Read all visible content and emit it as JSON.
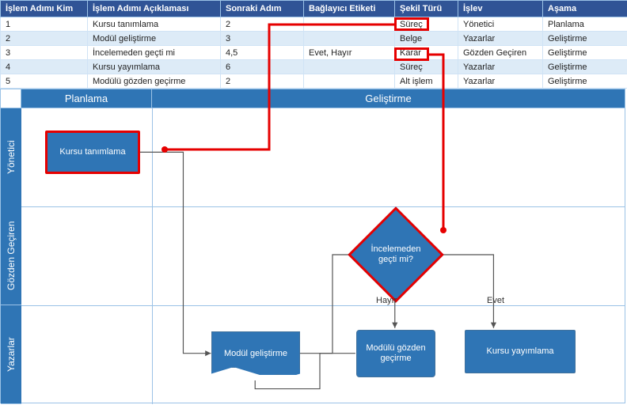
{
  "table": {
    "headers": [
      "İşlem Adımı Kim",
      "İşlem Adımı Açıklaması",
      "Sonraki Adım",
      "Bağlayıcı Etiketi",
      "Şekil Türü",
      "İşlev",
      "Aşama"
    ],
    "highlighted_header_index": 4,
    "rows": [
      {
        "id": "1",
        "desc": "Kursu tanımlama",
        "next": "2",
        "connector": "",
        "shape": "Süreç",
        "func": "Yönetici",
        "stage": "Planlama"
      },
      {
        "id": "2",
        "desc": "Modül geliştirme",
        "next": "3",
        "connector": "",
        "shape": "Belge",
        "func": "Yazarlar",
        "stage": "Geliştirme"
      },
      {
        "id": "3",
        "desc": "İncelemeden geçti mi",
        "next": "4,5",
        "connector": "Evet, Hayır",
        "shape": "Karar",
        "func": "Gözden Geçiren",
        "stage": "Geliştirme"
      },
      {
        "id": "4",
        "desc": "Kursu yayımlama",
        "next": "6",
        "connector": "",
        "shape": "Süreç",
        "func": "Yazarlar",
        "stage": "Geliştirme"
      },
      {
        "id": "5",
        "desc": "Modülü gözden geçirme",
        "next": "2",
        "connector": "",
        "shape": "Alt işlem",
        "func": "Yazarlar",
        "stage": "Geliştirme"
      }
    ]
  },
  "chart": {
    "phases": [
      "Planlama",
      "Geliştirme"
    ],
    "lanes": [
      "Yönetici",
      "Gözden Geçiren",
      "Yazarlar"
    ],
    "shapes": {
      "kursu_tanimla": "Kursu tanımlama",
      "modul_gelistirme": "Modül\ngeliştirme",
      "modulu_gozden": "Modülü\ngözden\ngeçirme",
      "kursu_yayim": "Kursu yayımlama",
      "karar": "İncelemeden\ngeçti mi?"
    },
    "edge_labels": {
      "hayir": "Hayır",
      "evet": "Evet"
    }
  }
}
